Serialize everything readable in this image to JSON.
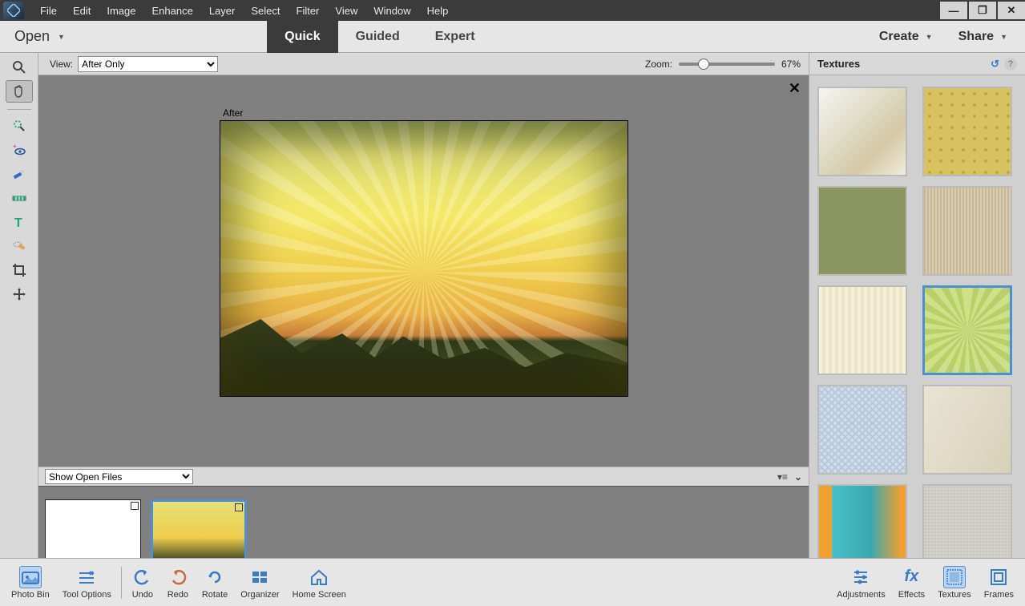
{
  "menu": {
    "items": [
      "File",
      "Edit",
      "Image",
      "Enhance",
      "Layer",
      "Select",
      "Filter",
      "View",
      "Window",
      "Help"
    ]
  },
  "modebar": {
    "open": "Open",
    "tabs": [
      "Quick",
      "Guided",
      "Expert"
    ],
    "active_tab": "Quick",
    "create": "Create",
    "share": "Share"
  },
  "viewbar": {
    "view_label": "View:",
    "view_value": "After Only",
    "zoom_label": "Zoom:",
    "zoom_value": "67%"
  },
  "canvas": {
    "after_label": "After"
  },
  "binbar": {
    "filter_value": "Show Open Files"
  },
  "sidepanel": {
    "title": "Textures"
  },
  "textures": [
    {
      "name": "peeling-paint",
      "sel": false,
      "cls": "t1"
    },
    {
      "name": "gold-dots",
      "sel": false,
      "cls": "t2"
    },
    {
      "name": "olive-canvas",
      "sel": false,
      "cls": "t3"
    },
    {
      "name": "beige-fiber",
      "sel": false,
      "cls": "t4"
    },
    {
      "name": "cream-stripe",
      "sel": false,
      "cls": "t5"
    },
    {
      "name": "green-sunburst",
      "sel": true,
      "cls": "t6"
    },
    {
      "name": "blue-weave",
      "sel": false,
      "cls": "t7"
    },
    {
      "name": "parchment",
      "sel": false,
      "cls": "t8"
    },
    {
      "name": "teal-orange",
      "sel": false,
      "cls": "t9"
    },
    {
      "name": "silver-grain",
      "sel": false,
      "cls": "t10"
    }
  ],
  "bottombar": {
    "left": [
      {
        "label": "Photo Bin",
        "name": "photo-bin",
        "active": true
      },
      {
        "label": "Tool Options",
        "name": "tool-options",
        "active": false
      }
    ],
    "mid": [
      {
        "label": "Undo",
        "name": "undo"
      },
      {
        "label": "Redo",
        "name": "redo"
      },
      {
        "label": "Rotate",
        "name": "rotate"
      },
      {
        "label": "Organizer",
        "name": "organizer"
      },
      {
        "label": "Home Screen",
        "name": "home-screen"
      }
    ],
    "right": [
      {
        "label": "Adjustments",
        "name": "adjustments",
        "active": false
      },
      {
        "label": "Effects",
        "name": "effects",
        "active": false
      },
      {
        "label": "Textures",
        "name": "textures",
        "active": true
      },
      {
        "label": "Frames",
        "name": "frames",
        "active": false
      }
    ]
  },
  "tools": [
    {
      "name": "zoom-tool",
      "active": false
    },
    {
      "name": "hand-tool",
      "active": true
    }
  ],
  "tools2": [
    {
      "name": "quick-select-tool"
    },
    {
      "name": "eye-tool"
    },
    {
      "name": "whiten-tool"
    },
    {
      "name": "straighten-tool"
    },
    {
      "name": "text-tool"
    },
    {
      "name": "spot-heal-tool"
    },
    {
      "name": "crop-tool"
    },
    {
      "name": "move-tool"
    }
  ]
}
